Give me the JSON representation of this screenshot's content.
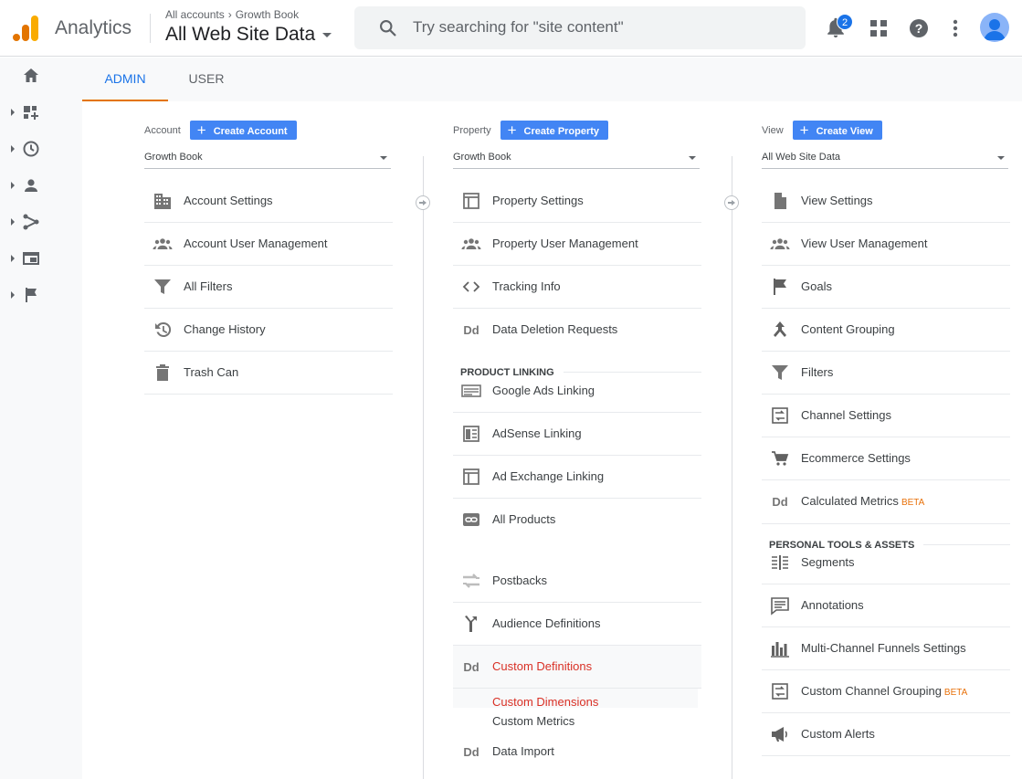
{
  "header": {
    "app_name": "Analytics",
    "breadcrumb": [
      "All accounts",
      "Growth Book"
    ],
    "view_title": "All Web Site Data",
    "search_placeholder": "Try searching for \"site content\"",
    "notification_count": "2"
  },
  "tabs": [
    {
      "label": "ADMIN",
      "active": true
    },
    {
      "label": "USER",
      "active": false
    }
  ],
  "rail_icons": [
    "home-icon",
    "dashboard-icon",
    "clock-icon",
    "person-icon",
    "acquisition-icon",
    "behavior-icon",
    "flag-icon"
  ],
  "columns": {
    "account": {
      "label": "Account",
      "create_label": "Create Account",
      "selected": "Growth Book",
      "items": [
        {
          "label": "Account Settings",
          "icon": "building-icon"
        },
        {
          "label": "Account User Management",
          "icon": "people-icon"
        },
        {
          "label": "All Filters",
          "icon": "filter-icon"
        },
        {
          "label": "Change History",
          "icon": "history-icon"
        },
        {
          "label": "Trash Can",
          "icon": "trash-icon"
        }
      ]
    },
    "property": {
      "label": "Property",
      "create_label": "Create Property",
      "selected": "Growth Book",
      "items": [
        {
          "label": "Property Settings",
          "icon": "window-icon"
        },
        {
          "label": "Property User Management",
          "icon": "people-icon"
        },
        {
          "label": "Tracking Info",
          "icon": "code-icon"
        },
        {
          "label": "Data Deletion Requests",
          "icon": "dd-icon"
        }
      ],
      "section_product_linking": "PRODUCT LINKING",
      "linking_items": [
        {
          "label": "Google Ads Linking",
          "icon": "ads-icon"
        },
        {
          "label": "AdSense Linking",
          "icon": "adsense-icon"
        },
        {
          "label": "Ad Exchange Linking",
          "icon": "window-icon"
        },
        {
          "label": "All Products",
          "icon": "link-icon"
        }
      ],
      "more_items": [
        {
          "label": "Postbacks",
          "icon": "postbacks-icon"
        },
        {
          "label": "Audience Definitions",
          "icon": "audience-icon"
        },
        {
          "label": "Custom Definitions",
          "icon": "dd-icon",
          "selected": true
        }
      ],
      "sub_items": [
        "Custom Dimensions",
        "Custom Metrics"
      ],
      "last_item": {
        "label": "Data Import",
        "icon": "dd-icon"
      }
    },
    "view": {
      "label": "View",
      "create_label": "Create View",
      "selected": "All Web Site Data",
      "items": [
        {
          "label": "View Settings",
          "icon": "document-icon"
        },
        {
          "label": "View User Management",
          "icon": "people-icon"
        },
        {
          "label": "Goals",
          "icon": "flag-icon"
        },
        {
          "label": "Content Grouping",
          "icon": "grouping-icon"
        },
        {
          "label": "Filters",
          "icon": "filter-icon"
        },
        {
          "label": "Channel Settings",
          "icon": "channel-icon"
        },
        {
          "label": "Ecommerce Settings",
          "icon": "cart-icon"
        },
        {
          "label": "Calculated Metrics",
          "icon": "dd-icon",
          "beta": "BETA"
        }
      ],
      "section_personal": "PERSONAL TOOLS & ASSETS",
      "personal_items": [
        {
          "label": "Segments",
          "icon": "segments-icon"
        },
        {
          "label": "Annotations",
          "icon": "annotation-icon"
        },
        {
          "label": "Multi-Channel Funnels Settings",
          "icon": "funnel-bars-icon"
        },
        {
          "label": "Custom Channel Grouping",
          "icon": "channel-icon",
          "beta": "BETA"
        },
        {
          "label": "Custom Alerts",
          "icon": "megaphone-icon"
        }
      ]
    }
  }
}
